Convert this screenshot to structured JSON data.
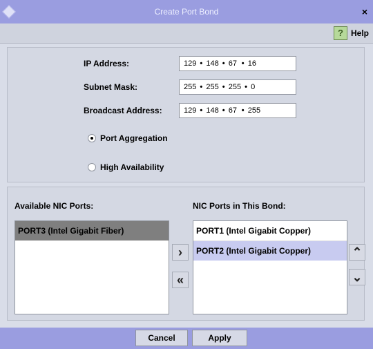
{
  "window": {
    "title": "Create Port Bond",
    "close_label": "×"
  },
  "header": {
    "help_label": "Help",
    "help_icon_glyph": "?"
  },
  "form": {
    "ip_address": {
      "label": "IP Address:",
      "octets": [
        "129",
        "148",
        "67",
        "16"
      ]
    },
    "subnet_mask": {
      "label": "Subnet Mask:",
      "octets": [
        "255",
        "255",
        "255",
        "0"
      ]
    },
    "broadcast_address": {
      "label": "Broadcast Address:",
      "octets": [
        "129",
        "148",
        "67",
        "255"
      ]
    },
    "modes": [
      {
        "label": "Port Aggregation",
        "checked": true
      },
      {
        "label": "High Availability",
        "checked": false
      }
    ]
  },
  "ports": {
    "available_title": "Available NIC Ports:",
    "bond_title": "NIC Ports in This Bond:",
    "available": [
      "PORT3  (Intel Gigabit Fiber)"
    ],
    "bonded": [
      "PORT1  (Intel Gigabit Copper)",
      "PORT2  (Intel Gigabit Copper)"
    ]
  },
  "arrows": {
    "add": "›",
    "remove": "«",
    "move_up": "⌃",
    "move_down": "⌄"
  },
  "footer": {
    "cancel_label": "Cancel",
    "apply_label": "Apply"
  },
  "colors": {
    "titlebar": "#9a9de0",
    "panel": "#d4d8e3",
    "selection_dark": "#7f7f7f",
    "selection_light": "#c8cbf0"
  }
}
